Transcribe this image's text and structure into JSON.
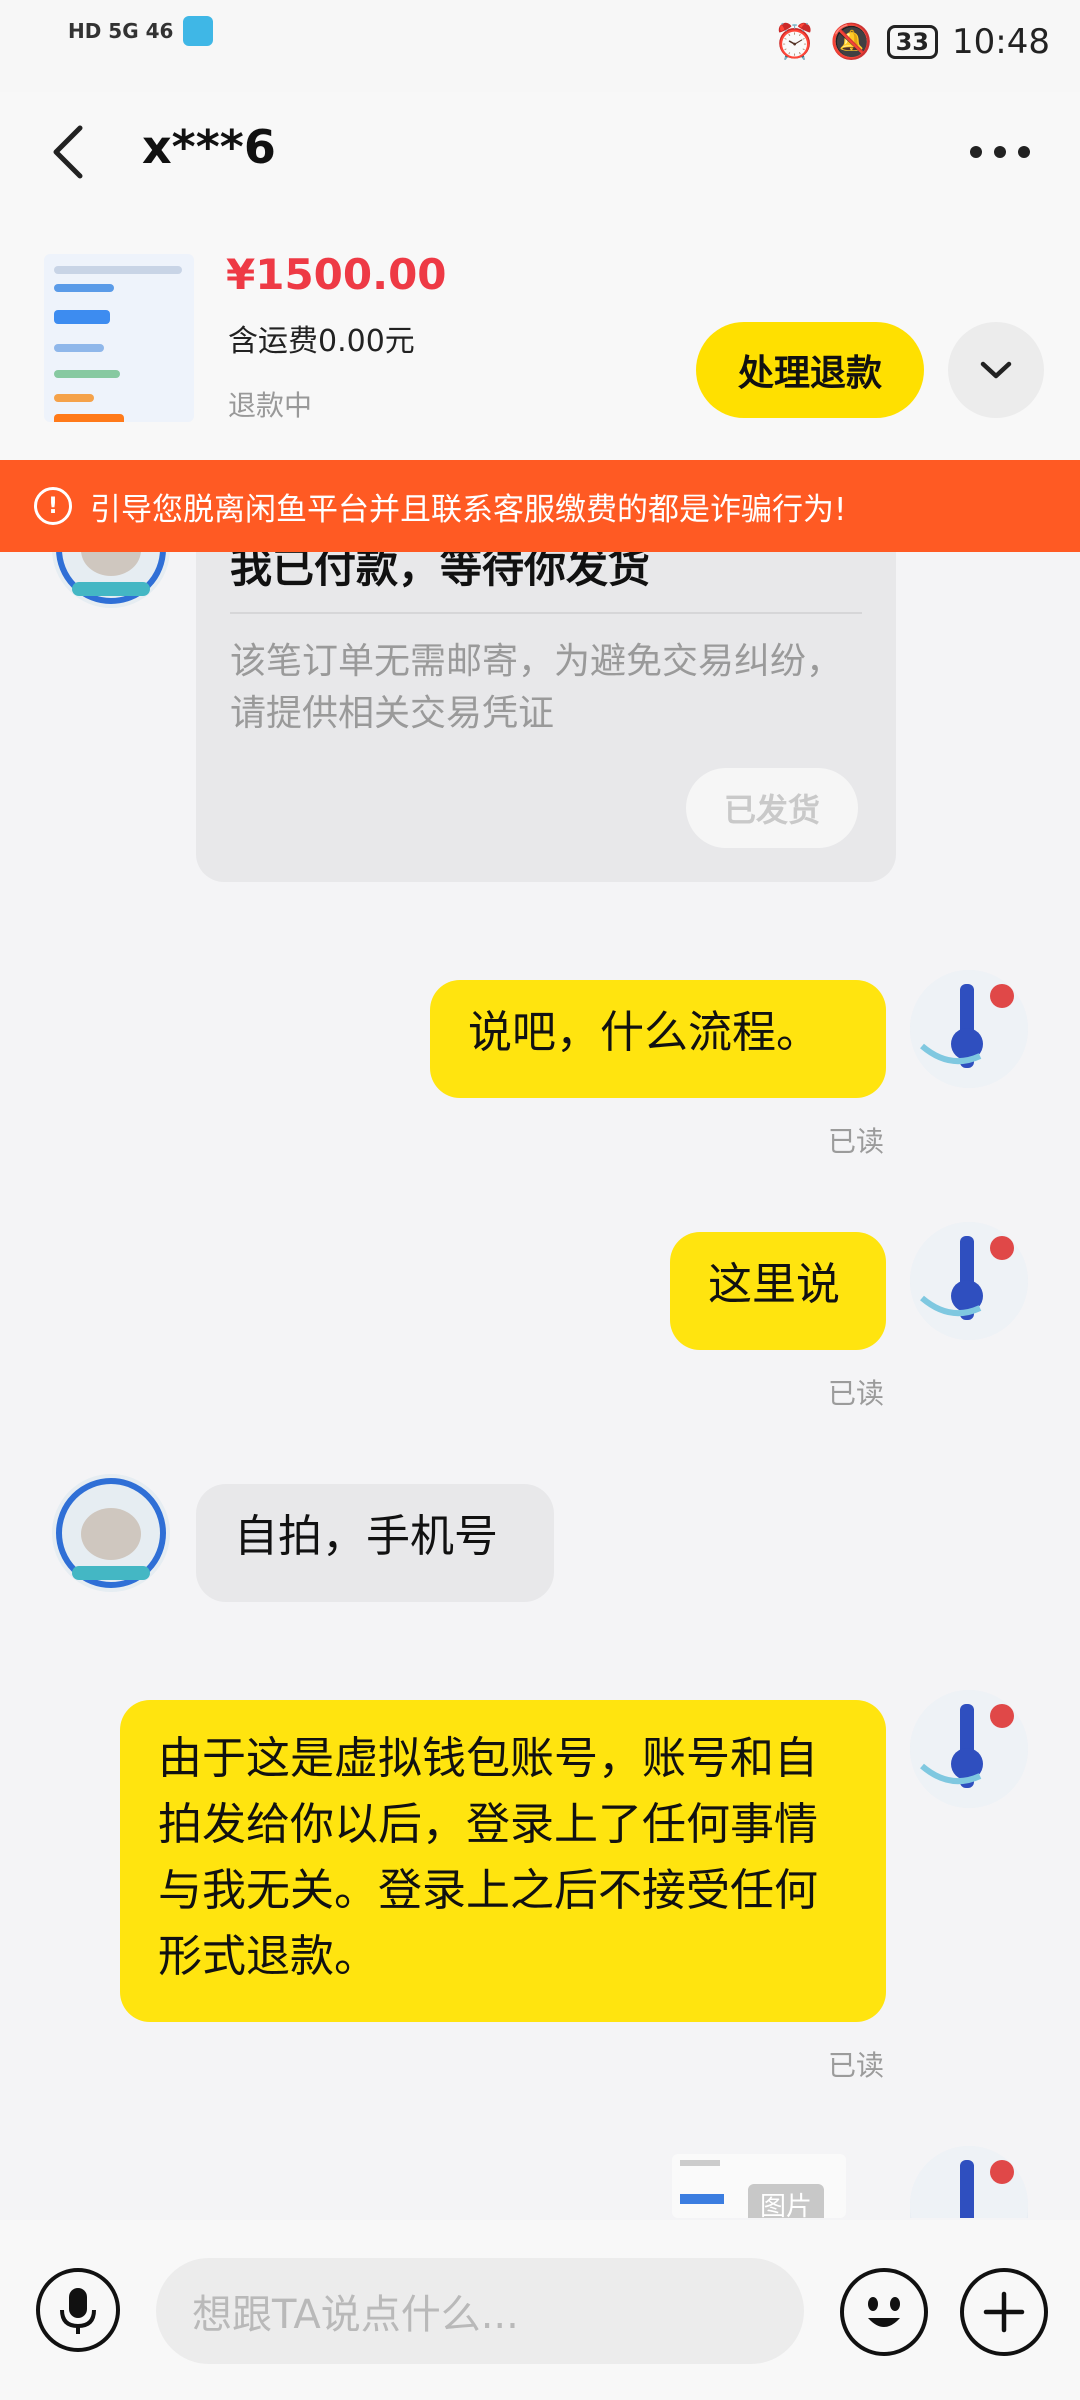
{
  "status_bar": {
    "left_label": "HD 5G 46",
    "battery": "33",
    "time": "10:48"
  },
  "header": {
    "title": "x***6"
  },
  "product": {
    "price": "¥1500.00",
    "shipping": "含运费0.00元",
    "status": "退款中",
    "refund_button": "处理退款"
  },
  "warning": {
    "text": "引导您脱离闲鱼平台并且联系客服缴费的都是诈骗行为!"
  },
  "order_card": {
    "title": "我已付款，等待你发货",
    "description": "该笔订单无需邮寄，为避免交易纠纷，请提供相关交易凭证",
    "button": "已发货"
  },
  "messages": [
    {
      "text": "说吧，什么流程。",
      "read": "已读"
    },
    {
      "text": "这里说",
      "read": "已读"
    },
    {
      "text": "自拍，手机号"
    },
    {
      "text": "由于这是虚拟钱包账号，账号和自拍发给你以后，登录上了任何事情与我无关。登录上之后不接受任何形式退款。",
      "read": "已读"
    }
  ],
  "image_message": {
    "label": "图片"
  },
  "input": {
    "placeholder": "想跟TA说点什么..."
  },
  "colors": {
    "accent_yellow": "#ffe40f",
    "price_red": "#ee3a45",
    "warning_orange": "#ff5a23"
  }
}
